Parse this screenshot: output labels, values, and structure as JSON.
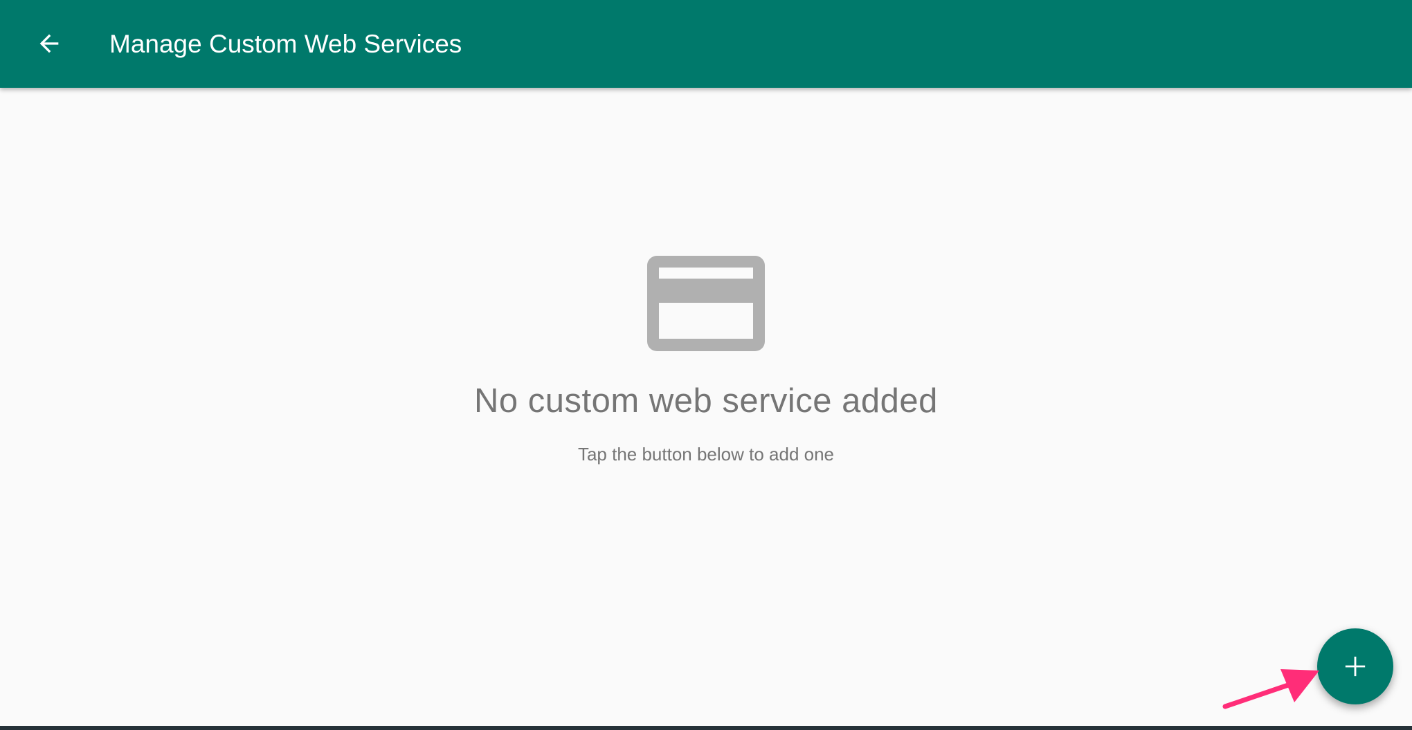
{
  "app_bar": {
    "title": "Manage Custom Web Services",
    "back_icon": "arrow-back-icon",
    "color": "#00796b"
  },
  "empty_state": {
    "icon": "web-service-card-icon",
    "title": "No custom web service added",
    "subtitle": "Tap the button below to add one"
  },
  "fab": {
    "icon": "plus-icon",
    "color": "#00796b"
  },
  "annotation": {
    "icon": "pointer-arrow-icon",
    "color": "#ff2d78"
  }
}
